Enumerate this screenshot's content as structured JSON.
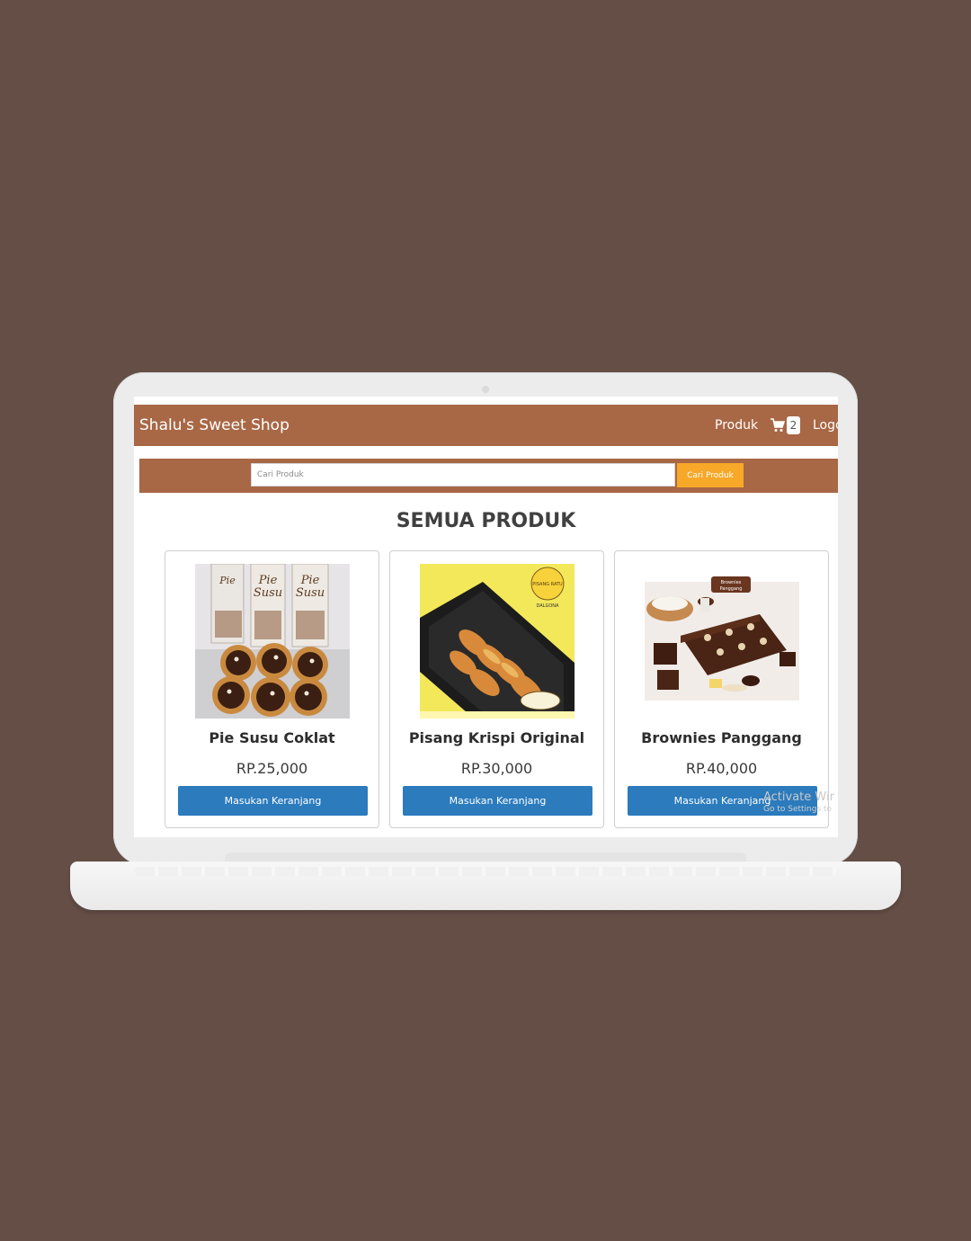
{
  "navbar": {
    "brand": "Shalu's Sweet Shop",
    "produk_link": "Produk",
    "cart_count": "2",
    "logout_link": "Logo"
  },
  "search": {
    "placeholder": "Cari Produk",
    "value": "",
    "button_label": "Cari Produk"
  },
  "main": {
    "title": "SEMUA PRODUK"
  },
  "products": [
    {
      "name": "Pie Susu Coklat",
      "price": "RP.25,000",
      "button": "Masukan Keranjang"
    },
    {
      "name": "Pisang Krispi Original",
      "price": "RP.30,000",
      "button": "Masukan Keranjang"
    },
    {
      "name": "Brownies Panggang",
      "price": "RP.40,000",
      "button": "Masukan Keranjang"
    }
  ],
  "watermark": {
    "line1": "Activate Wir",
    "line2": "Go to Settings to"
  },
  "colors": {
    "background": "#644e46",
    "navbar": "#a86745",
    "search_button": "#f7a829",
    "cart_button": "#2b7bbd"
  }
}
